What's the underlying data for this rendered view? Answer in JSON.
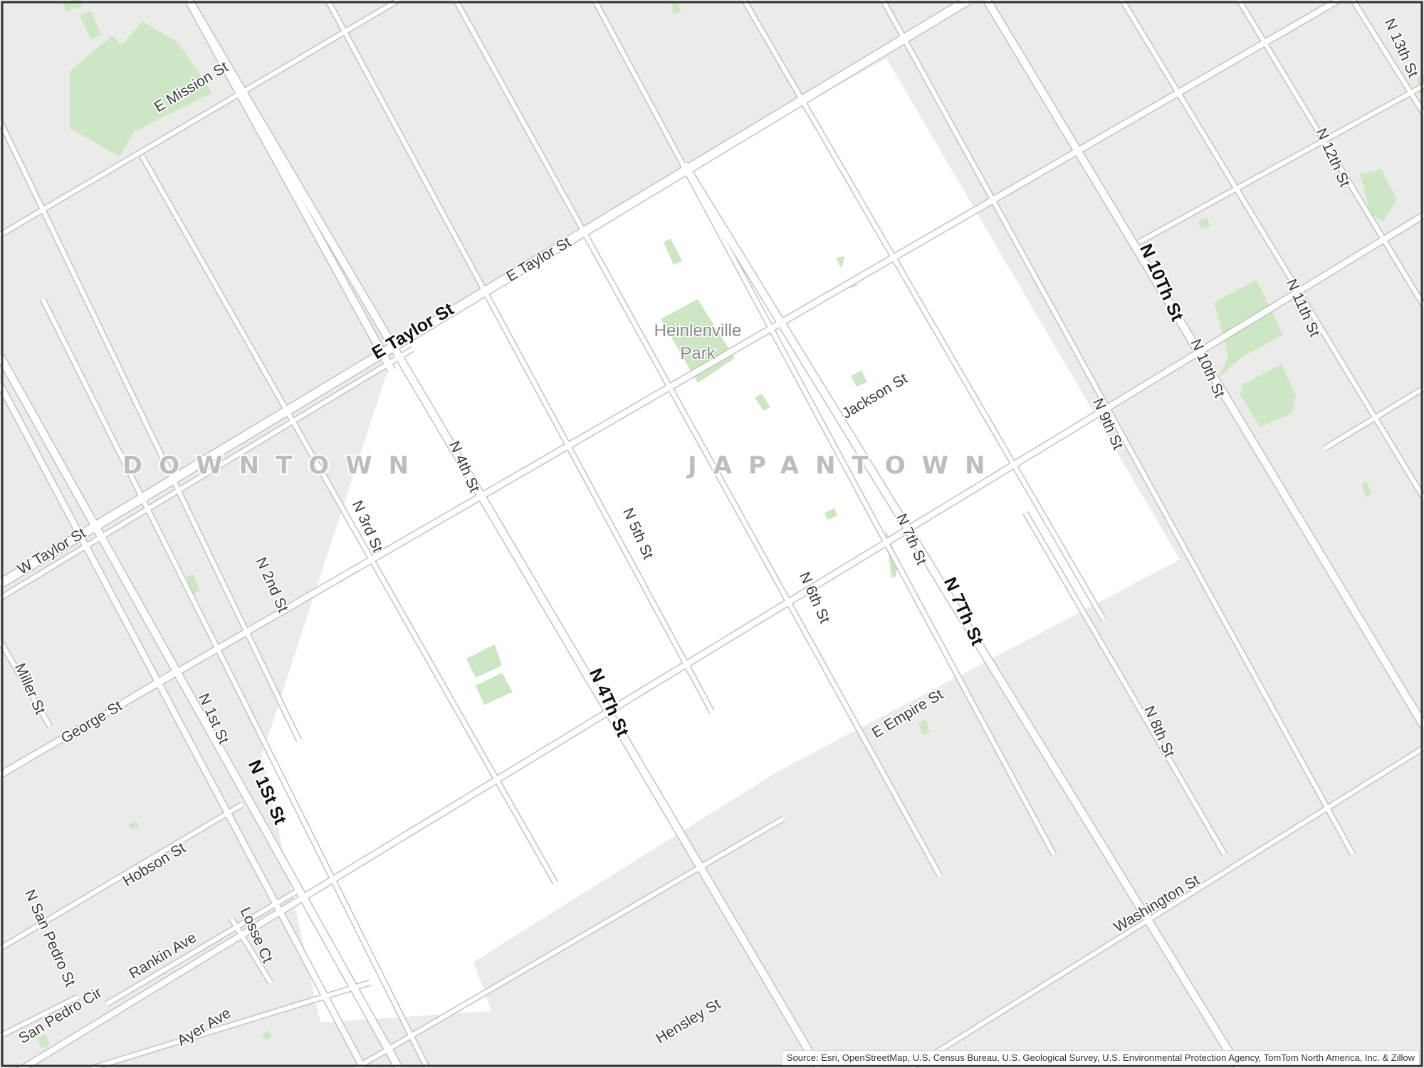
{
  "map": {
    "colors": {
      "base": "#ebebea",
      "highlight_area": "#ffffff",
      "park": "#cde6c3",
      "road_casing": "#c2c2c2",
      "road_fill": "#ffffff",
      "frame": "#333333"
    },
    "neighborhoods": {
      "downtown": "DOWNTOWN",
      "japantown": "JAPANTOWN"
    },
    "park": {
      "line1": "Heinlenville",
      "line2": "Park"
    },
    "streets": {
      "e_mission": "E Mission St",
      "e_taylor_minor": "E Taylor St",
      "e_taylor_major": "E Taylor St",
      "w_taylor": "W Taylor St",
      "jackson": "Jackson St",
      "e_empire": "E Empire St",
      "george": "George St",
      "hobson": "Hobson St",
      "rankin": "Rankin Ave",
      "ayer": "Ayer Ave",
      "san_pedro_cir": "San Pedro Cir",
      "hensley": "Hensley St",
      "washington": "Washington St",
      "miller": "Miller St",
      "n_san_pedro": "N San Pedro St",
      "losse": "Losse Ct",
      "n_1st_minor": "N 1st St",
      "n_1st_major": "N 1St St",
      "n_2nd": "N 2nd St",
      "n_3rd": "N 3rd St",
      "n_4th_minor": "N 4th St",
      "n_4th_major": "N 4Th St",
      "n_5th": "N 5th St",
      "n_6th": "N 6th St",
      "n_7th_minor": "N 7th St",
      "n_7th_major": "N 7Th St",
      "n_8th": "N 8th St",
      "n_9th": "N 9th St",
      "n_10th_major": "N 10Th St",
      "n_10th_minor": "N 10th St",
      "n_11th": "N 11th St",
      "n_12th": "N 12th St",
      "n_13th": "N 13th St"
    },
    "attribution": "Source: Esri, OpenStreetMap, U.S. Census Bureau, U.S. Geological Survey, U.S. Environmental Protection Agency, TomTom North America, Inc. & Zillow"
  }
}
